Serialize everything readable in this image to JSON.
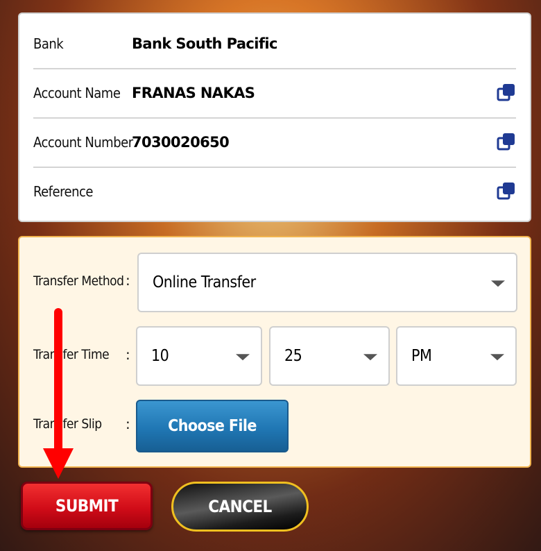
{
  "bank_details": {
    "bank_label": "Bank",
    "bank_value": "Bank South Pacific",
    "account_name_label": "Account Name",
    "account_name_value": "FRANAS NAKAS",
    "account_number_label": "Account Number",
    "account_number_value": "7030020650",
    "reference_label": "Reference",
    "reference_value": ""
  },
  "form": {
    "transfer_method_label": "Transfer Method",
    "transfer_method_value": "Online Transfer",
    "transfer_time_label": "Transfer Time",
    "time_hour": "10",
    "time_minute": "25",
    "time_ampm": "PM",
    "transfer_slip_label": "Transfer Slip",
    "choose_file_label": "Choose File",
    "colon": ":"
  },
  "actions": {
    "submit_label": "SUBMIT",
    "cancel_label": "CANCEL"
  },
  "colors": {
    "copy_icon": "#1f3a93",
    "annotation_arrow": "#ff0000",
    "form_background": "#fff6e5",
    "form_border": "#f1b44f"
  }
}
